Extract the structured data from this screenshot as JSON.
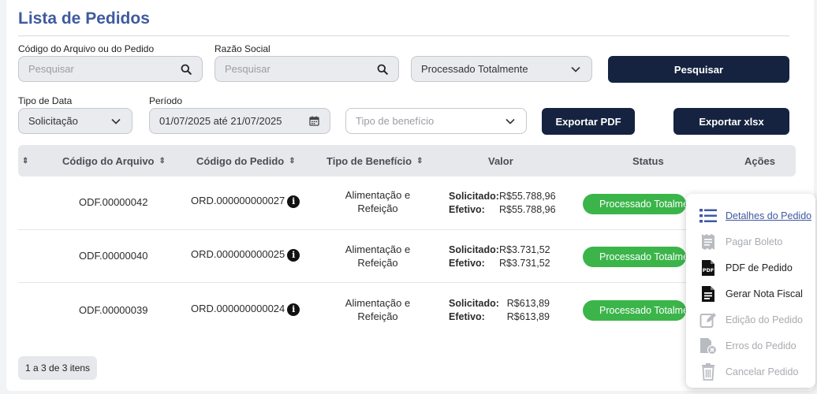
{
  "page": {
    "title": "Lista de Pedidos"
  },
  "filters": {
    "codigo_label": "Código do Arquivo ou do Pedido",
    "codigo_placeholder": "Pesquisar",
    "razao_label": "Razão Social",
    "razao_placeholder": "Pesquisar",
    "status_value": "Processado Totalmente",
    "search_button": "Pesquisar",
    "tipo_data_label": "Tipo de Data",
    "tipo_data_value": "Solicitação",
    "periodo_label": "Período",
    "periodo_value": "01/07/2025 até 21/07/2025",
    "tipo_beneficio_placeholder": "Tipo de benefício",
    "export_pdf": "Exportar PDF",
    "export_xlsx": "Exportar xlsx"
  },
  "table": {
    "headers": {
      "codigo_arquivo": "Código do Arquivo",
      "codigo_pedido": "Código do Pedido",
      "tipo_beneficio": "Tipo de Benefício",
      "valor": "Valor",
      "status": "Status",
      "acoes": "Ações"
    },
    "sort_glyph": "⇕",
    "rows": [
      {
        "arquivo": "ODF.00000042",
        "pedido": "ORD.000000000027",
        "beneficio1": "Alimentação e",
        "beneficio2": "Refeição",
        "sol_label": "Solicitado:",
        "sol": "R$55.788,96",
        "ef_label": "Efetivo:",
        "ef": "R$55.788,96",
        "status": "Processado Totalmente"
      },
      {
        "arquivo": "ODF.00000040",
        "pedido": "ORD.000000000025",
        "beneficio1": "Alimentação e",
        "beneficio2": "Refeição",
        "sol_label": "Solicitado:",
        "sol": "R$3.731,52",
        "ef_label": "Efetivo:",
        "ef": "R$3.731,52",
        "status": "Processado Totalmente"
      },
      {
        "arquivo": "ODF.00000039",
        "pedido": "ORD.000000000024",
        "beneficio1": "Alimentação e",
        "beneficio2": "Refeição",
        "sol_label": "Solicitado:",
        "sol": "R$613,89",
        "ef_label": "Efetivo:",
        "ef": "R$613,89",
        "status": "Processado Totalmente"
      }
    ]
  },
  "pagination": {
    "text": "1 a 3 de 3 itens"
  },
  "actions_menu": {
    "items": [
      {
        "label": "Detalhes do Pedido",
        "icon": "list-icon",
        "enabled": true
      },
      {
        "label": "Pagar Boleto",
        "icon": "receipt-icon",
        "enabled": false
      },
      {
        "label": "PDF de Pedido",
        "icon": "pdf-file-icon",
        "enabled": true
      },
      {
        "label": "Gerar Nota Fiscal",
        "icon": "invoice-icon",
        "enabled": true
      },
      {
        "label": "Edição do Pedido",
        "icon": "edit-icon",
        "enabled": false
      },
      {
        "label": "Erros do Pedido",
        "icon": "file-error-icon",
        "enabled": false
      },
      {
        "label": "Cancelar Pedido",
        "icon": "trash-icon",
        "enabled": false
      }
    ]
  },
  "colors": {
    "accent": "#3f5aa0",
    "button": "#152340",
    "status_green": "#3bb54a"
  }
}
